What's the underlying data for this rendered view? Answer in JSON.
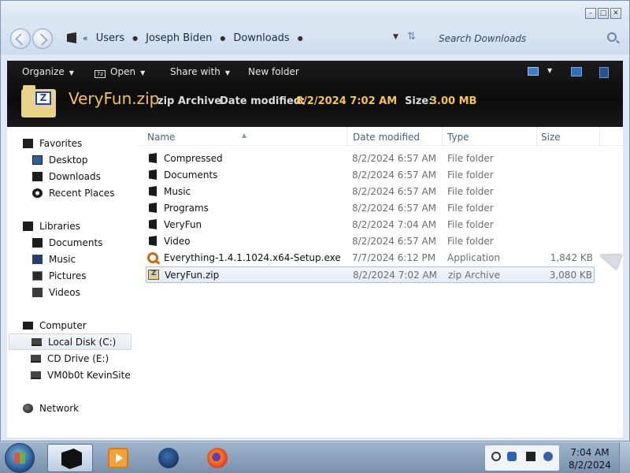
{
  "window": {
    "controls": {
      "minimize": "–",
      "maximize": "□",
      "close": "✕"
    }
  },
  "address": {
    "lead": "«",
    "crumbs": [
      "Users",
      "Joseph Biden",
      "Downloads"
    ],
    "search_placeholder": "Search Downloads"
  },
  "toolbar": {
    "organize": "Organize",
    "open": "Open",
    "open_icon": "7z",
    "share": "Share with",
    "new_folder": "New folder"
  },
  "details": {
    "name": "VeryFun.zip",
    "type": "zip Archive",
    "date_label": "Date modified:",
    "date_value": "8/2/2024 7:02 AM",
    "size_label": "Size:",
    "size_value": "3.00 MB"
  },
  "nav": {
    "favorites": "Favorites",
    "desktop": "Desktop",
    "downloads": "Downloads",
    "recent": "Recent Places",
    "libraries": "Libraries",
    "documents": "Documents",
    "music": "Music",
    "pictures": "Pictures",
    "videos": "Videos",
    "computer": "Computer",
    "local_disk": "Local Disk (C:)",
    "cd_drive": "CD Drive (E:)",
    "vm_share": "VM0b0t KevinSite",
    "network": "Network"
  },
  "columns": {
    "name": "Name",
    "date": "Date modified",
    "type": "Type",
    "size": "Size"
  },
  "files": [
    {
      "name": "Compressed",
      "date": "8/2/2024 6:57 AM",
      "type": "File folder",
      "size": ""
    },
    {
      "name": "Documents",
      "date": "8/2/2024 6:57 AM",
      "type": "File folder",
      "size": ""
    },
    {
      "name": "Music",
      "date": "8/2/2024 6:57 AM",
      "type": "File folder",
      "size": ""
    },
    {
      "name": "Programs",
      "date": "8/2/2024 6:57 AM",
      "type": "File folder",
      "size": ""
    },
    {
      "name": "VeryFun",
      "date": "8/2/2024 7:04 AM",
      "type": "File folder",
      "size": ""
    },
    {
      "name": "Video",
      "date": "8/2/2024 6:57 AM",
      "type": "File folder",
      "size": ""
    },
    {
      "name": "Everything-1.4.1.1024.x64-Setup.exe",
      "date": "7/7/2024 6:12 PM",
      "type": "Application",
      "size": "1,842 KB"
    },
    {
      "name": "VeryFun.zip",
      "date": "8/2/2024 7:02 AM",
      "type": "zip Archive",
      "size": "3,080 KB"
    }
  ],
  "taskbar": {
    "time": "7:04 AM",
    "date": "8/2/2024"
  }
}
